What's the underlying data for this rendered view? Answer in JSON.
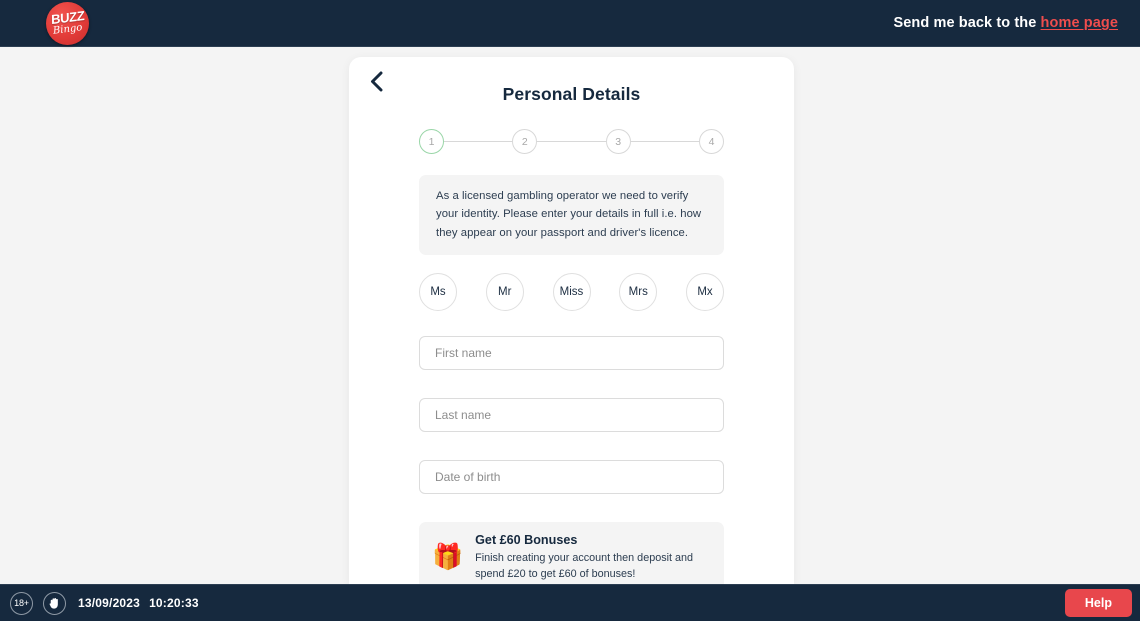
{
  "header": {
    "logo": {
      "word_top": "BUZZ",
      "word_bottom": "Bingo",
      "icon": "buzz-bingo-logo"
    },
    "nav_prefix": "Send me back to the ",
    "nav_link": "home page"
  },
  "card": {
    "back_icon": "chevron-left-icon",
    "title": "Personal Details",
    "stepper": {
      "steps": [
        {
          "label": "1",
          "state": "active"
        },
        {
          "label": "2",
          "state": "inactive"
        },
        {
          "label": "3",
          "state": "inactive"
        },
        {
          "label": "4",
          "state": "inactive"
        }
      ],
      "active_color": "#9ad6a8",
      "inactive_color": "#d8d8d8"
    },
    "info_text": "As a licensed gambling operator we need to verify your identity. Please enter your details in full i.e. how they appear on your passport and driver's licence.",
    "titles": [
      {
        "label": "Ms"
      },
      {
        "label": "Mr"
      },
      {
        "label": "Miss"
      },
      {
        "label": "Mrs"
      },
      {
        "label": "Mx"
      }
    ],
    "fields": {
      "first_name": {
        "placeholder": "First name",
        "value": ""
      },
      "last_name": {
        "placeholder": "Last name",
        "value": ""
      },
      "date_of_birth": {
        "placeholder": "Date of birth",
        "value": ""
      }
    },
    "promo": {
      "icon": "gift-icon",
      "icon_glyph": "🎁",
      "title": "Get £60 Bonuses",
      "text": "Finish creating your account then deposit and spend £20 to get £60 of bonuses!"
    }
  },
  "footer": {
    "age_badge": "18+",
    "hand_icon": "stop-hand-icon",
    "date": "13/09/2023",
    "time": "10:20:33",
    "help_label": "Help",
    "help_color": "#e8474c"
  }
}
